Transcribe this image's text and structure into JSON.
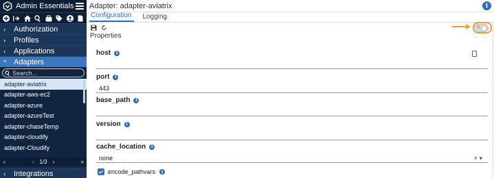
{
  "app": {
    "title": "Admin Essentials"
  },
  "toolbar_icons": [
    "add-icon",
    "logout-icon",
    "home-icon",
    "search-icon",
    "briefcase-icon",
    "tag-icon",
    "user-icon",
    "document-icon"
  ],
  "sidebar": {
    "sections_top": [
      {
        "label": "Authorization",
        "chevron": "›"
      },
      {
        "label": "Profiles",
        "chevron": "›"
      },
      {
        "label": "Applications",
        "chevron": "›"
      }
    ],
    "active_section": {
      "label": "Adapters",
      "chevron": "^"
    },
    "search": {
      "placeholder": "Search..."
    },
    "adapters": [
      "adapter-aviatrix",
      "adapter-aws-ec2",
      "adapter-azure",
      "adapter-azureTest",
      "adapter-chaseTemp",
      "adapter-cloudify",
      "adapter-Cloudify"
    ],
    "selected_adapter": "adapter-aviatrix",
    "pager": {
      "first": "«",
      "prev": "‹",
      "page": "1/3",
      "next": "›",
      "last": "»"
    },
    "sections_bottom": [
      {
        "label": "Integrations",
        "chevron": "›"
      }
    ]
  },
  "main": {
    "title": "Adapter: adapter-aviatrix",
    "tabs": [
      {
        "label": "Configuration",
        "active": true
      },
      {
        "label": "Logging",
        "active": false
      }
    ],
    "toggle_state": "off",
    "properties_title": "Properties",
    "fields": [
      {
        "label": "host",
        "value": ""
      },
      {
        "label": "port",
        "value": "443"
      },
      {
        "label": "base_path",
        "value": ""
      },
      {
        "label": "version",
        "value": ""
      },
      {
        "label": "cache_location",
        "value": "none",
        "trail": "× ▾"
      }
    ],
    "checkbox": {
      "label": "encode_pathvars",
      "checked": true
    }
  },
  "colors": {
    "sidebar_bg": "#112540",
    "accent": "#2f6fb8",
    "highlight": "#f29c38"
  }
}
